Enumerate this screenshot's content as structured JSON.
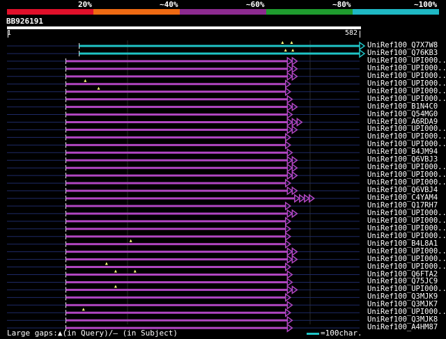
{
  "scale": {
    "labels": [
      "20%",
      "~40%",
      "~60%",
      "~80%",
      "~100%"
    ],
    "colors": [
      "#e0102a",
      "#ee6a13",
      "#8c2a8f",
      "#1f9b2e",
      "#1fb8c4"
    ]
  },
  "query": {
    "id": "BB926191",
    "start": "1",
    "end": "582",
    "length": 582
  },
  "footer": {
    "gaps_text": "Large gaps:▲(in Query)/– (in Subject)",
    "scale_text": "=100char."
  },
  "colors": {
    "cyan": "#1fc4c6",
    "magenta": "#b146c2",
    "background": "#000000",
    "dim_line": "#1e2a66"
  },
  "hits": [
    {
      "label": "UniRef100_Q7X7W8",
      "color": "cyan",
      "start": 120,
      "end": 582,
      "markers": [
        455,
        470
      ],
      "arrows": 1
    },
    {
      "label": "UniRef100_Q76KB3",
      "color": "cyan",
      "start": 120,
      "end": 582,
      "markers": [
        460,
        472
      ],
      "arrows": 1
    },
    {
      "label": "UniRef100_UPI000..",
      "color": "magenta",
      "start": 98,
      "end": 463,
      "markers": [],
      "arrows": 2
    },
    {
      "label": "UniRef100_UPI000..",
      "color": "magenta",
      "start": 98,
      "end": 463,
      "markers": [],
      "arrows": 2
    },
    {
      "label": "UniRef100_UPI000..",
      "color": "magenta",
      "start": 98,
      "end": 463,
      "markers": [],
      "arrows": 2
    },
    {
      "label": "UniRef100_UPI000..",
      "color": "magenta",
      "start": 98,
      "end": 460,
      "markers": [
        130
      ],
      "arrows": 1
    },
    {
      "label": "UniRef100_UPI000..",
      "color": "magenta",
      "start": 98,
      "end": 460,
      "markers": [
        152
      ],
      "arrows": 1
    },
    {
      "label": "UniRef100_UPI000..",
      "color": "magenta",
      "start": 98,
      "end": 463,
      "markers": [],
      "arrows": 1
    },
    {
      "label": "UniRef100_B1N4C0",
      "color": "magenta",
      "start": 98,
      "end": 463,
      "markers": [],
      "arrows": 2
    },
    {
      "label": "UniRef100_Q54MG0",
      "color": "magenta",
      "start": 98,
      "end": 463,
      "markers": [],
      "arrows": 1
    },
    {
      "label": "UniRef100_A6RDA9",
      "color": "magenta",
      "start": 98,
      "end": 463,
      "markers": [],
      "arrows": 3
    },
    {
      "label": "UniRef100_UPI000..",
      "color": "magenta",
      "start": 98,
      "end": 463,
      "markers": [],
      "arrows": 2
    },
    {
      "label": "UniRef100_UPI000..",
      "color": "magenta",
      "start": 98,
      "end": 460,
      "markers": [],
      "arrows": 1
    },
    {
      "label": "UniRef100_UPI000..",
      "color": "magenta",
      "start": 98,
      "end": 460,
      "markers": [],
      "arrows": 1
    },
    {
      "label": "UniRef100_B4JM94",
      "color": "magenta",
      "start": 98,
      "end": 463,
      "markers": [],
      "arrows": 1
    },
    {
      "label": "UniRef100_Q6VBJ3",
      "color": "magenta",
      "start": 98,
      "end": 463,
      "markers": [],
      "arrows": 2
    },
    {
      "label": "UniRef100_UPI000..",
      "color": "magenta",
      "start": 98,
      "end": 463,
      "markers": [],
      "arrows": 2
    },
    {
      "label": "UniRef100_UPI000..",
      "color": "magenta",
      "start": 98,
      "end": 463,
      "markers": [],
      "arrows": 2
    },
    {
      "label": "UniRef100_UPI000..",
      "color": "magenta",
      "start": 98,
      "end": 460,
      "markers": [],
      "arrows": 1
    },
    {
      "label": "UniRef100_Q6VBJ4",
      "color": "magenta",
      "start": 98,
      "end": 463,
      "markers": [],
      "arrows": 2
    },
    {
      "label": "UniRef100_C4YAM4",
      "color": "magenta",
      "start": 98,
      "end": 475,
      "markers": [],
      "arrows": 4
    },
    {
      "label": "UniRef100_Q17RH7",
      "color": "magenta",
      "start": 98,
      "end": 460,
      "markers": [],
      "arrows": 1
    },
    {
      "label": "UniRef100_UPI000..",
      "color": "magenta",
      "start": 98,
      "end": 463,
      "markers": [],
      "arrows": 2
    },
    {
      "label": "UniRef100_UPI000..",
      "color": "magenta",
      "start": 98,
      "end": 460,
      "markers": [],
      "arrows": 1
    },
    {
      "label": "UniRef100_UPI000..",
      "color": "magenta",
      "start": 98,
      "end": 460,
      "markers": [],
      "arrows": 1
    },
    {
      "label": "UniRef100_UPI000..",
      "color": "magenta",
      "start": 98,
      "end": 460,
      "markers": [],
      "arrows": 1
    },
    {
      "label": "UniRef100_B4L8A1",
      "color": "magenta",
      "start": 98,
      "end": 460,
      "markers": [
        205
      ],
      "arrows": 1
    },
    {
      "label": "UniRef100_UPI000..",
      "color": "magenta",
      "start": 98,
      "end": 463,
      "markers": [],
      "arrows": 2
    },
    {
      "label": "UniRef100_UPI000..",
      "color": "magenta",
      "start": 98,
      "end": 463,
      "markers": [],
      "arrows": 2
    },
    {
      "label": "UniRef100_UPI000..",
      "color": "magenta",
      "start": 98,
      "end": 460,
      "markers": [
        165
      ],
      "arrows": 1
    },
    {
      "label": "UniRef100_Q6FTA2",
      "color": "magenta",
      "start": 98,
      "end": 463,
      "markers": [
        180,
        212
      ],
      "arrows": 1
    },
    {
      "label": "UniRef100_Q75JC9",
      "color": "magenta",
      "start": 98,
      "end": 463,
      "markers": [],
      "arrows": 1
    },
    {
      "label": "UniRef100_UPI000..",
      "color": "magenta",
      "start": 98,
      "end": 463,
      "markers": [
        180
      ],
      "arrows": 2
    },
    {
      "label": "UniRef100_Q3MJK9",
      "color": "magenta",
      "start": 98,
      "end": 460,
      "markers": [],
      "arrows": 1
    },
    {
      "label": "UniRef100_Q3MJK7",
      "color": "magenta",
      "start": 98,
      "end": 463,
      "markers": [],
      "arrows": 1
    },
    {
      "label": "UniRef100_UPI000..",
      "color": "magenta",
      "start": 98,
      "end": 460,
      "markers": [
        127
      ],
      "arrows": 1
    },
    {
      "label": "UniRef100_Q3MJK8",
      "color": "magenta",
      "start": 98,
      "end": 463,
      "markers": [],
      "arrows": 1
    },
    {
      "label": "UniRef100_A4HM87",
      "color": "magenta",
      "start": 98,
      "end": 463,
      "markers": [],
      "arrows": 1
    }
  ]
}
